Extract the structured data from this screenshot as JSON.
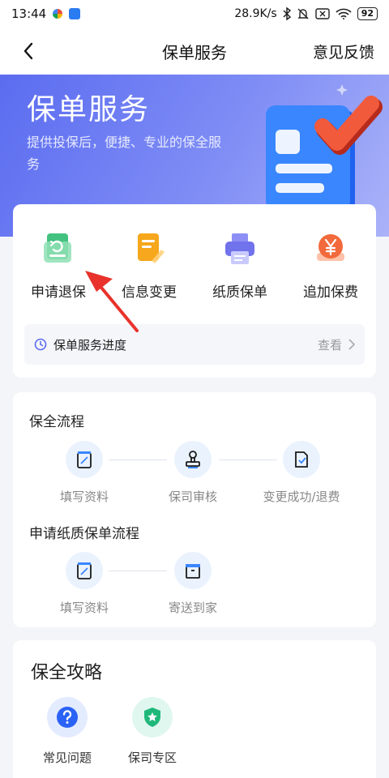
{
  "status_bar": {
    "time": "13:44",
    "net_speed": "28.9K/s",
    "battery": "92"
  },
  "nav": {
    "title": "保单服务",
    "feedback": "意见反馈"
  },
  "hero": {
    "title": "保单服务",
    "subtitle": "提供投保后，便捷、专业的保全服务"
  },
  "services": {
    "items": [
      {
        "label": "申请退保",
        "icon": "refund-document-icon"
      },
      {
        "label": "信息变更",
        "icon": "edit-document-icon"
      },
      {
        "label": "纸质保单",
        "icon": "printer-icon"
      },
      {
        "label": "追加保费",
        "icon": "yen-coin-icon"
      }
    ],
    "progress_label": "保单服务进度",
    "progress_action": "查看"
  },
  "flow": {
    "section1_title": "保全流程",
    "section1_steps": [
      "填写资料",
      "保司审核",
      "变更成功/退费"
    ],
    "section2_title": "申请纸质保单流程",
    "section2_steps": [
      "填写资料",
      "寄送到家"
    ]
  },
  "guide": {
    "title": "保全攻略",
    "items": [
      {
        "label": "常见问题",
        "icon": "question-icon"
      },
      {
        "label": "保司专区",
        "icon": "shield-star-icon"
      }
    ]
  },
  "colors": {
    "accent": "#5b6cf0",
    "annotation": "#e8322b"
  }
}
